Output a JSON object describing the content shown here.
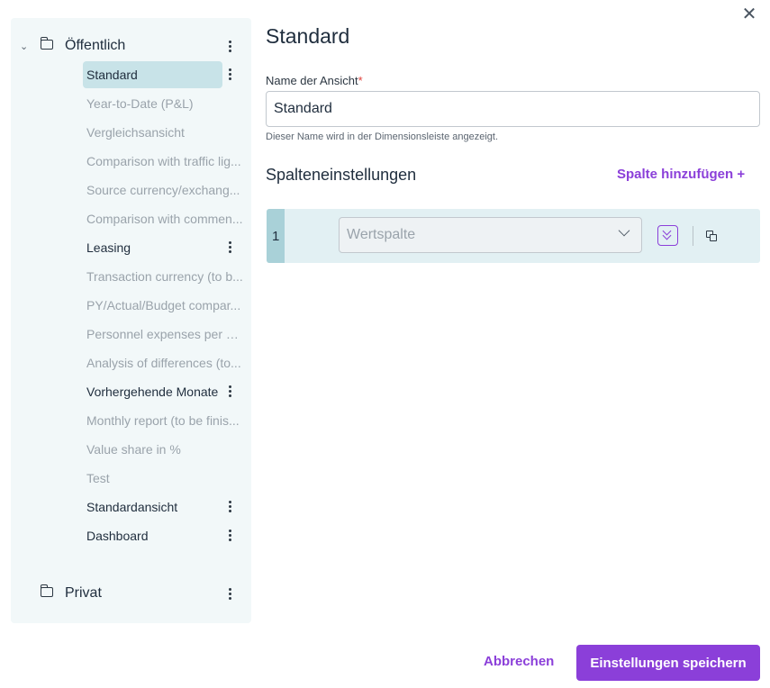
{
  "sidebar": {
    "public_folder": {
      "label": "Öffentlich",
      "expanded": true
    },
    "items": [
      {
        "label": "Standard",
        "state": "selected",
        "menu": true
      },
      {
        "label": "Year-to-Date (P&L)",
        "state": "muted",
        "menu": false
      },
      {
        "label": "Vergleichsansicht",
        "state": "muted",
        "menu": false
      },
      {
        "label": "Comparison with traffic lig...",
        "state": "muted",
        "menu": false
      },
      {
        "label": "Source currency/exchang...",
        "state": "muted",
        "menu": false
      },
      {
        "label": "Comparison with commen...",
        "state": "muted",
        "menu": false
      },
      {
        "label": "Leasing",
        "state": "dark",
        "menu": true
      },
      {
        "label": "Transaction currency (to b...",
        "state": "muted",
        "menu": false
      },
      {
        "label": "PY/Actual/Budget compar...",
        "state": "muted",
        "menu": false
      },
      {
        "label": "Personnel expenses per e...",
        "state": "muted",
        "menu": false
      },
      {
        "label": "Analysis of differences (to...",
        "state": "muted",
        "menu": false
      },
      {
        "label": "Vorhergehende Monate",
        "state": "dark",
        "menu": true
      },
      {
        "label": "Monthly report (to be finis...",
        "state": "muted",
        "menu": false
      },
      {
        "label": "Value share in %",
        "state": "muted",
        "menu": false
      },
      {
        "label": "Test",
        "state": "muted",
        "menu": false
      },
      {
        "label": "Standardansicht",
        "state": "dark",
        "menu": true
      },
      {
        "label": "Dashboard",
        "state": "dark",
        "menu": true
      }
    ],
    "private_folder": {
      "label": "Privat"
    }
  },
  "main": {
    "title": "Standard",
    "name_label": "Name der Ansicht",
    "required_marker": "*",
    "name_value": "Standard",
    "hint": "Dieser Name wird in der Dimensionsleiste angezeigt.",
    "columns_title": "Spalteneinstellungen",
    "add_column": "Spalte hinzufügen +",
    "columns": [
      {
        "number": "1",
        "placeholder": "Wertspalte"
      }
    ]
  },
  "footer": {
    "cancel": "Abbrechen",
    "save": "Einstellungen speichern"
  },
  "colors": {
    "accent": "#8b3fd9",
    "sidebar_bg": "#f2f8f9",
    "selected_bg": "#c8e3e8",
    "column_row_bg": "#e2f0f3"
  },
  "icons": [
    "close-icon",
    "chevron-down-icon",
    "folder-icon",
    "kebab-menu-icon",
    "expand-icon",
    "copy-icon"
  ]
}
